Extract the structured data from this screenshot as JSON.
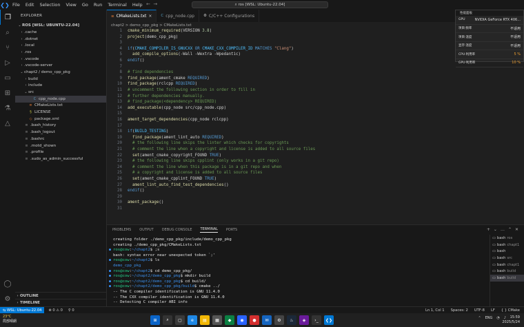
{
  "titlebar": {
    "menu": [
      "File",
      "Edit",
      "Selection",
      "View",
      "Go",
      "Run",
      "Terminal",
      "Help"
    ],
    "search": "ros [WSL: Ubuntu-22.04]"
  },
  "sidebar": {
    "header": "EXPLORER",
    "root": "ROS [WSL: UBUNTU-22.04]",
    "items": [
      {
        "label": ".cache",
        "type": "folder",
        "depth": 1
      },
      {
        "label": ".dotnet",
        "type": "folder",
        "depth": 1
      },
      {
        "label": ".local",
        "type": "folder",
        "depth": 1
      },
      {
        "label": ".ros",
        "type": "folder",
        "depth": 1
      },
      {
        "label": ".vscode",
        "type": "folder",
        "depth": 1
      },
      {
        "label": ".vscode-server",
        "type": "folder",
        "depth": 1
      },
      {
        "label": "chapt2 / demo_cpp_pkg",
        "type": "folder-open",
        "depth": 1
      },
      {
        "label": "build",
        "type": "folder",
        "depth": 2
      },
      {
        "label": "include",
        "type": "folder",
        "depth": 2
      },
      {
        "label": "src",
        "type": "folder-open",
        "depth": 2
      },
      {
        "label": "cpp_node.cpp",
        "type": "cpp",
        "depth": 3,
        "selected": true
      },
      {
        "label": "CMakeLists.txt",
        "type": "cmake",
        "depth": 2
      },
      {
        "label": "LICENSE",
        "type": "license",
        "depth": 2
      },
      {
        "label": "package.xml",
        "type": "xml",
        "depth": 2
      },
      {
        "label": ".bash_history",
        "type": "file",
        "depth": 1
      },
      {
        "label": ".bash_logout",
        "type": "file",
        "depth": 1
      },
      {
        "label": ".bashrc",
        "type": "file",
        "depth": 1
      },
      {
        "label": ".motd_shown",
        "type": "file",
        "depth": 1
      },
      {
        "label": ".profile",
        "type": "file",
        "depth": 1
      },
      {
        "label": ".sudo_as_admin_successful",
        "type": "file",
        "depth": 1
      }
    ],
    "outline": "OUTLINE",
    "timeline": "TIMELINE"
  },
  "tabs": [
    {
      "label": "CMakeLists.txt",
      "icon": "cmake-icon",
      "active": true
    },
    {
      "label": "cpp_node.cpp",
      "icon": "cpp-icon",
      "active": false
    },
    {
      "label": "C/C++ Configurations",
      "icon": "settings-icon",
      "active": false
    }
  ],
  "breadcrumb": "chapt2 > demo_cpp_pkg > CMakeLists.txt",
  "editor": {
    "lines": [
      {
        "n": "1",
        "seg": [
          [
            "fn",
            "cmake_minimum_required"
          ],
          [
            "pl",
            "(VERSION "
          ],
          [
            "num",
            "3.8"
          ],
          [
            "pl",
            ")"
          ]
        ]
      },
      {
        "n": "2",
        "seg": [
          [
            "fn",
            "project"
          ],
          [
            "pl",
            "(demo_cpp_pkg)"
          ]
        ]
      },
      {
        "n": "3",
        "seg": []
      },
      {
        "n": "4",
        "seg": [
          [
            "kw",
            "if"
          ],
          [
            "pl",
            "("
          ],
          [
            "def",
            "CMAKE_COMPILER_IS_GNUCXX"
          ],
          [
            "kw",
            " OR "
          ],
          [
            "def",
            "CMAKE_CXX_COMPILER_ID"
          ],
          [
            "kw",
            " MATCHES "
          ],
          [
            "str",
            "\"Clang\""
          ],
          [
            "pl",
            ")"
          ]
        ]
      },
      {
        "n": "5",
        "seg": [
          [
            "pl",
            "  "
          ],
          [
            "fn",
            "add_compile_options"
          ],
          [
            "pl",
            "(-Wall -Wextra -Wpedantic)"
          ]
        ]
      },
      {
        "n": "6",
        "seg": [
          [
            "kw",
            "endif"
          ],
          [
            "pl",
            "()"
          ]
        ]
      },
      {
        "n": "7",
        "seg": []
      },
      {
        "n": "8",
        "seg": [
          [
            "cm",
            "# find dependencies"
          ]
        ]
      },
      {
        "n": "9",
        "seg": [
          [
            "fn",
            "find_package"
          ],
          [
            "pl",
            "(ament_cmake "
          ],
          [
            "kw",
            "REQUIRED"
          ],
          [
            "pl",
            ")"
          ]
        ]
      },
      {
        "n": "10",
        "seg": [
          [
            "fn",
            "find_package"
          ],
          [
            "pl",
            "(rclcpp "
          ],
          [
            "kw",
            "REQUIRED"
          ],
          [
            "pl",
            ")"
          ]
        ]
      },
      {
        "n": "11",
        "seg": [
          [
            "cm",
            "# uncomment the following section in order to fill in"
          ]
        ]
      },
      {
        "n": "12",
        "seg": [
          [
            "cm",
            "# further dependencies manually."
          ]
        ]
      },
      {
        "n": "13",
        "seg": [
          [
            "cm",
            "# find_package(<dependency> REQUIRED)"
          ]
        ]
      },
      {
        "n": "14",
        "seg": [
          [
            "fn",
            "add_executable"
          ],
          [
            "pl",
            "(cpp_node src/cpp_node.cpp)"
          ]
        ]
      },
      {
        "n": "15",
        "seg": []
      },
      {
        "n": "16",
        "seg": [
          [
            "fn",
            "ament_target_dependencies"
          ],
          [
            "pl",
            "(cpp_node rclcpp)"
          ]
        ]
      },
      {
        "n": "17",
        "seg": []
      },
      {
        "n": "18",
        "seg": [
          [
            "kw",
            "if"
          ],
          [
            "pl",
            "("
          ],
          [
            "def",
            "BUILD_TESTING"
          ],
          [
            "pl",
            ")"
          ]
        ]
      },
      {
        "n": "19",
        "seg": [
          [
            "pl",
            "  "
          ],
          [
            "fn",
            "find_package"
          ],
          [
            "pl",
            "(ament_lint_auto "
          ],
          [
            "kw",
            "REQUIRED"
          ],
          [
            "pl",
            ")"
          ]
        ]
      },
      {
        "n": "20",
        "seg": [
          [
            "pl",
            "  "
          ],
          [
            "cm",
            "# the following line skips the linter which checks for copyrights"
          ]
        ]
      },
      {
        "n": "21",
        "seg": [
          [
            "pl",
            "  "
          ],
          [
            "cm",
            "# comment the line when a copyright and license is added to all source files"
          ]
        ]
      },
      {
        "n": "22",
        "seg": [
          [
            "pl",
            "  "
          ],
          [
            "fn",
            "set"
          ],
          [
            "pl",
            "(ament_cmake_copyright_FOUND "
          ],
          [
            "kw",
            "TRUE"
          ],
          [
            "pl",
            ")"
          ]
        ]
      },
      {
        "n": "23",
        "seg": [
          [
            "pl",
            "  "
          ],
          [
            "cm",
            "# the following line skips cpplint (only works in a git repo)"
          ]
        ]
      },
      {
        "n": "24",
        "seg": [
          [
            "pl",
            "  "
          ],
          [
            "cm",
            "# comment the line when this package is in a git repo and when"
          ]
        ]
      },
      {
        "n": "25",
        "seg": [
          [
            "pl",
            "  "
          ],
          [
            "cm",
            "# a copyright and license is added to all source files"
          ]
        ]
      },
      {
        "n": "26",
        "seg": [
          [
            "pl",
            "  "
          ],
          [
            "fn",
            "set"
          ],
          [
            "pl",
            "(ament_cmake_cpplint_FOUND "
          ],
          [
            "kw",
            "TRUE"
          ],
          [
            "pl",
            ")"
          ]
        ]
      },
      {
        "n": "27",
        "seg": [
          [
            "pl",
            "  "
          ],
          [
            "fn",
            "ament_lint_auto_find_test_dependencies"
          ],
          [
            "pl",
            "()"
          ]
        ]
      },
      {
        "n": "28",
        "seg": [
          [
            "kw",
            "endif"
          ],
          [
            "pl",
            "()"
          ]
        ]
      },
      {
        "n": "29",
        "seg": []
      },
      {
        "n": "30",
        "seg": [
          [
            "fn",
            "ament_package"
          ],
          [
            "pl",
            "()"
          ]
        ]
      },
      {
        "n": "31",
        "seg": []
      }
    ]
  },
  "overlay": {
    "title": "性能面板",
    "rows": [
      {
        "label": "GPU",
        "value": "NVIDIA GeForce RTX 406..."
      },
      {
        "label": "项目·频率",
        "value": "不适用"
      },
      {
        "label": "项目·温度",
        "value": "不适用"
      },
      {
        "label": "显存·温度",
        "value": "不适用"
      },
      {
        "label": "CPU·利用率",
        "value": "5 %"
      },
      {
        "label": "GPU·利用率",
        "value": "10 %"
      }
    ]
  },
  "panel": {
    "tabs": [
      "PROBLEMS",
      "OUTPUT",
      "DEBUG CONSOLE",
      "TERMINAL",
      "PORTS"
    ],
    "active_tab": "TERMINAL",
    "terminal": [
      {
        "g": "",
        "seg": [
          [
            "wht",
            "creating folder ./demo_cpp_pkg/include/demo_cpp_pkg"
          ]
        ]
      },
      {
        "g": "",
        "seg": [
          [
            "wht",
            "creating ./demo_cpp_pkg/CMakeLists.txt"
          ]
        ]
      },
      {
        "g": "●",
        "seg": [
          [
            "grn",
            "ros@cow"
          ],
          [
            "wht",
            ":"
          ],
          [
            "blu",
            "~/chapt2"
          ],
          [
            "wht",
            "$ ;s"
          ]
        ]
      },
      {
        "g": "",
        "seg": [
          [
            "wht",
            "bash: syntax error near unexpected token `;'"
          ]
        ]
      },
      {
        "g": "●",
        "seg": [
          [
            "grn",
            "ros@cow"
          ],
          [
            "wht",
            ":"
          ],
          [
            "blu",
            "~/chapt2"
          ],
          [
            "wht",
            "$ ls"
          ]
        ]
      },
      {
        "g": "",
        "seg": [
          [
            "blu",
            "demo_cpp_pkg"
          ]
        ]
      },
      {
        "g": "●",
        "seg": [
          [
            "grn",
            "ros@cow"
          ],
          [
            "wht",
            ":"
          ],
          [
            "blu",
            "~/chapt2"
          ],
          [
            "wht",
            "$ cd demo_cpp_pkg/"
          ]
        ]
      },
      {
        "g": "●",
        "seg": [
          [
            "grn",
            "ros@cow"
          ],
          [
            "wht",
            ":"
          ],
          [
            "blu",
            "~/chapt2/demo_cpp_pkg"
          ],
          [
            "wht",
            "$ mkdir build"
          ]
        ]
      },
      {
        "g": "●",
        "seg": [
          [
            "grn",
            "ros@cow"
          ],
          [
            "wht",
            ":"
          ],
          [
            "blu",
            "~/chapt2/demo_cpp_pkg"
          ],
          [
            "wht",
            "$ cd build/"
          ]
        ]
      },
      {
        "g": "●",
        "seg": [
          [
            "grn",
            "ros@cow"
          ],
          [
            "wht",
            ":"
          ],
          [
            "blu",
            "~/chapt2/demo_cpp_pkg/build"
          ],
          [
            "wht",
            "$ cmake ../"
          ]
        ]
      },
      {
        "g": "",
        "seg": [
          [
            "wht",
            "-- The C compiler identification is GNU 11.4.0"
          ]
        ]
      },
      {
        "g": "",
        "seg": [
          [
            "wht",
            "-- The CXX compiler identification is GNU 11.4.0"
          ]
        ]
      },
      {
        "g": "",
        "seg": [
          [
            "wht",
            "-- Detecting C compiler ABI info"
          ]
        ]
      }
    ],
    "terminal_list": [
      {
        "name": "bash",
        "tag": "ros"
      },
      {
        "name": "bash",
        "tag": "chapt1"
      },
      {
        "name": "bash",
        "tag": ""
      },
      {
        "name": "bash",
        "tag": "src"
      },
      {
        "name": "bash",
        "tag": "chapt1"
      },
      {
        "name": "bash",
        "tag": "build"
      },
      {
        "name": "bash",
        "tag": "build"
      }
    ]
  },
  "status": {
    "remote": "WSL: Ubuntu-22.04",
    "problems": "⊗ 0  ⚠ 0",
    "ports": "⚲ 0",
    "right": [
      "Ln 1, Col 1",
      "Spaces: 2",
      "UTF-8",
      "LF",
      "{ } CMake"
    ]
  },
  "taskbar": {
    "temp": "23°C",
    "weather": "局部晴朗",
    "lang": "ENG",
    "time": "15:59",
    "date": "2025/5/24"
  }
}
